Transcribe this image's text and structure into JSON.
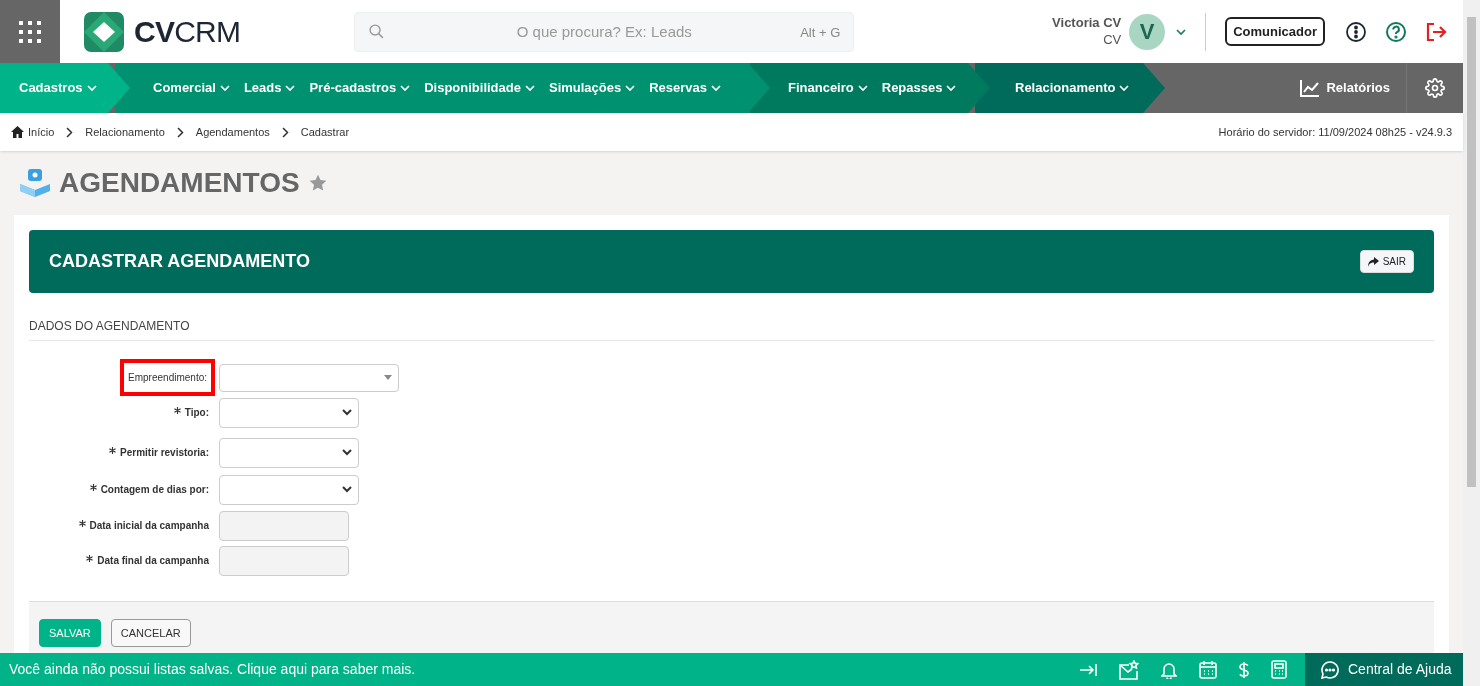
{
  "header": {
    "logo": {
      "bold": "CV",
      "light": "CRM"
    },
    "search": {
      "placeholder": "O que procura? Ex: Leads",
      "shortcut": "Alt + G"
    },
    "user": {
      "name": "Victoria CV",
      "company": "CV",
      "initial": "V"
    },
    "communicator_button": "Comunicador"
  },
  "nav": {
    "groups": [
      {
        "items": [
          {
            "label": "Cadastros"
          }
        ]
      },
      {
        "items": [
          {
            "label": "Comercial"
          },
          {
            "label": "Leads"
          },
          {
            "label": "Pré-cadastros"
          },
          {
            "label": "Disponibilidade"
          },
          {
            "label": "Simulações"
          },
          {
            "label": "Reservas"
          }
        ]
      },
      {
        "items": [
          {
            "label": "Financeiro"
          },
          {
            "label": "Repasses"
          }
        ]
      },
      {
        "items": [
          {
            "label": "Relacionamento"
          }
        ]
      }
    ],
    "reports": "Relatórios"
  },
  "breadcrumb": [
    "Início",
    "Relacionamento",
    "Agendamentos",
    "Cadastrar"
  ],
  "server_time": "Horário do servidor: 11/09/2024 08h25 - v24.9.3",
  "page_title": "AGENDAMENTOS",
  "form": {
    "title": "CADASTRAR AGENDAMENTO",
    "exit_button": "SAIR",
    "section": "DADOS DO AGENDAMENTO",
    "fields": [
      {
        "label": "Empreendimento:",
        "kind": "autocomplete",
        "required": false,
        "highlighted": true,
        "disabled": false
      },
      {
        "label": "Tipo:",
        "kind": "select",
        "required": true,
        "highlighted": false,
        "disabled": false
      },
      {
        "label": "Permitir revistoria:",
        "kind": "select",
        "required": true,
        "highlighted": false,
        "disabled": false
      },
      {
        "label": "Contagem de dias por:",
        "kind": "select",
        "required": true,
        "highlighted": false,
        "disabled": false
      },
      {
        "label": "Data inicial da campanha",
        "kind": "text",
        "required": true,
        "highlighted": false,
        "disabled": true
      },
      {
        "label": "Data final da campanha",
        "kind": "text",
        "required": true,
        "highlighted": false,
        "disabled": true
      }
    ],
    "buttons": [
      {
        "label": "SALVAR",
        "kind": "primary"
      },
      {
        "label": "CANCELAR",
        "kind": "secondary"
      }
    ]
  },
  "footer": {
    "message": "Você ainda não possui listas salvas. Clique aqui para saber mais.",
    "help": "Central de Ajuda"
  }
}
